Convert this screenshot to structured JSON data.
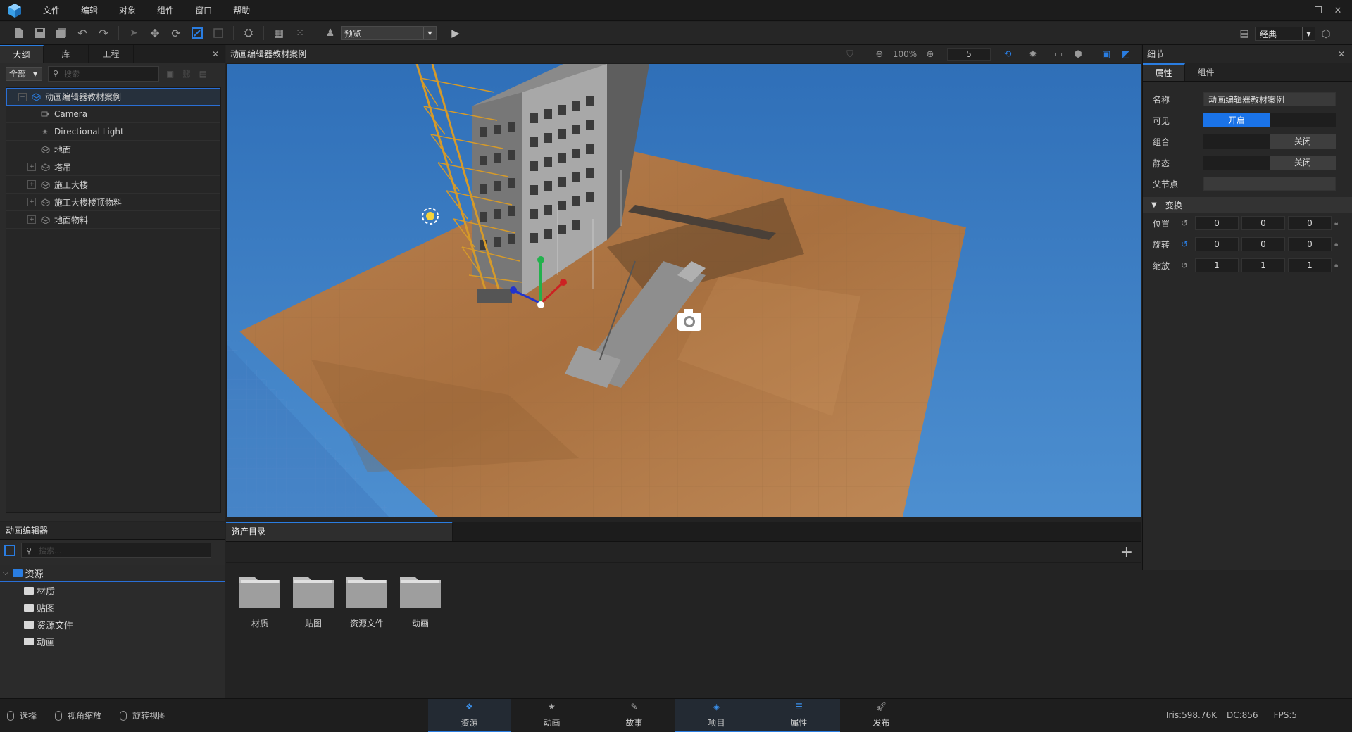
{
  "menu": [
    "文件",
    "编辑",
    "对象",
    "组件",
    "窗口",
    "帮助"
  ],
  "toolbar": {
    "mode_select": "预览",
    "layout_select": "经典"
  },
  "outline": {
    "tabs": [
      "大纲",
      "库",
      "工程"
    ],
    "filter": "全部",
    "search_placeholder": "搜索",
    "items": [
      {
        "label": "动画编辑器教材案例",
        "icon": "object-icon",
        "expanded": true
      },
      {
        "label": "Camera",
        "icon": "camera-icon"
      },
      {
        "label": "Directional Light",
        "icon": "light-icon"
      },
      {
        "label": "地面",
        "icon": "object-icon"
      },
      {
        "label": "塔吊",
        "icon": "object-icon",
        "collapsed": true
      },
      {
        "label": "施工大楼",
        "icon": "object-icon",
        "collapsed": true
      },
      {
        "label": "施工大楼楼顶物料",
        "icon": "object-icon",
        "collapsed": true
      },
      {
        "label": "地面物料",
        "icon": "object-icon",
        "collapsed": true
      }
    ]
  },
  "viewport": {
    "title": "动画编辑器教材案例",
    "zoom": "100%",
    "grid_value": "5"
  },
  "details": {
    "title": "细节",
    "tabs": [
      "属性",
      "组件"
    ],
    "name_label": "名称",
    "name_value": "动画编辑器教材案例",
    "visible_label": "可见",
    "visible_value": "开启",
    "group_label": "组合",
    "group_value": "关闭",
    "static_label": "静态",
    "static_value": "关闭",
    "parent_label": "父节点",
    "transform_section": "变换",
    "transform": [
      {
        "label": "位置",
        "values": [
          "0",
          "0",
          "0"
        ]
      },
      {
        "label": "旋转",
        "values": [
          "0",
          "0",
          "0"
        ]
      },
      {
        "label": "缩放",
        "values": [
          "1",
          "1",
          "1"
        ]
      }
    ]
  },
  "anim_editor": {
    "title": "动画编辑器",
    "search_placeholder": "搜索...",
    "root": "资源",
    "children": [
      "材质",
      "贴图",
      "资源文件",
      "动画"
    ]
  },
  "assets": {
    "tab": "资产目录",
    "folders": [
      "材质",
      "贴图",
      "资源文件",
      "动画"
    ]
  },
  "statusbar": {
    "hints": [
      "选择",
      "视角缩放",
      "旋转视图"
    ],
    "tabs": [
      {
        "label": "资源",
        "icon": "resource-icon",
        "active": true
      },
      {
        "label": "动画",
        "icon": "animation-icon",
        "active": false
      },
      {
        "label": "故事",
        "icon": "story-icon",
        "active": false
      },
      {
        "label": "项目",
        "icon": "project-icon",
        "active": true
      },
      {
        "label": "属性",
        "icon": "properties-icon",
        "active": true
      },
      {
        "label": "发布",
        "icon": "publish-icon",
        "active": false
      }
    ],
    "tris": "Tris:598.76K",
    "dc": "DC:856",
    "fps": "FPS:5"
  },
  "colors": {
    "accent": "#1a73e8",
    "panel": "#2b2b2b",
    "sky": "#3d7ec2",
    "ground": "#b57a4c"
  }
}
